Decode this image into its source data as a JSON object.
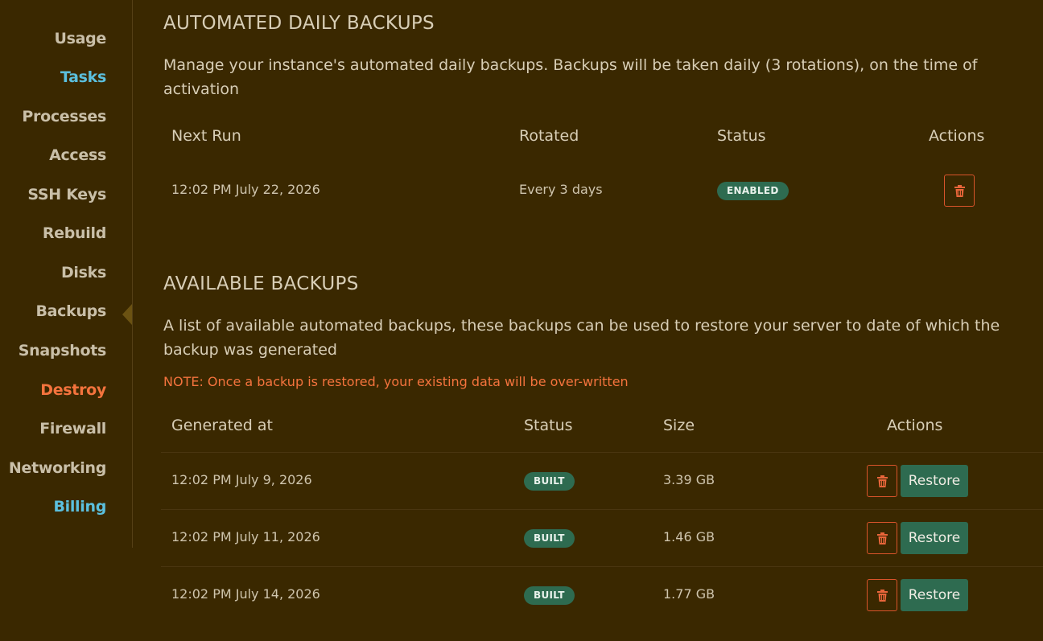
{
  "sidebar": {
    "items": [
      {
        "label": "Usage"
      },
      {
        "label": "Tasks"
      },
      {
        "label": "Processes"
      },
      {
        "label": "Access"
      },
      {
        "label": "SSH Keys"
      },
      {
        "label": "Rebuild"
      },
      {
        "label": "Disks"
      },
      {
        "label": "Backups"
      },
      {
        "label": "Snapshots"
      },
      {
        "label": "Destroy"
      },
      {
        "label": "Firewall"
      },
      {
        "label": "Networking"
      },
      {
        "label": "Billing"
      }
    ],
    "active": "Backups"
  },
  "daily": {
    "title": "AUTOMATED DAILY BACKUPS",
    "description": "Manage your instance's automated daily backups. Backups will be taken daily (3 rotations), on the time of activation",
    "headers": {
      "next_run": "Next Run",
      "rotated": "Rotated",
      "status": "Status",
      "actions": "Actions"
    },
    "row": {
      "next_run": "12:02 PM July 22, 2026",
      "rotated": "Every 3 days",
      "status": "ENABLED"
    }
  },
  "available": {
    "title": "AVAILABLE BACKUPS",
    "description": "A list of available automated backups, these backups can be used to restore your server to date of which the backup was generated",
    "note": "NOTE: Once a backup is restored, your existing data will be over-written",
    "headers": {
      "generated_at": "Generated at",
      "status": "Status",
      "size": "Size",
      "actions": "Actions"
    },
    "rows": [
      {
        "generated_at": "12:02 PM July 9, 2026",
        "status": "BUILT",
        "size": "3.39 GB",
        "restore_label": "Restore"
      },
      {
        "generated_at": "12:02 PM July 11, 2026",
        "status": "BUILT",
        "size": "1.46 GB",
        "restore_label": "Restore"
      },
      {
        "generated_at": "12:02 PM July 14, 2026",
        "status": "BUILT",
        "size": "1.77 GB",
        "restore_label": "Restore"
      }
    ]
  },
  "colors": {
    "background": "#3a2800",
    "link_blue": "#5bc0de",
    "danger": "#f4733d",
    "success": "#2e6b50"
  }
}
